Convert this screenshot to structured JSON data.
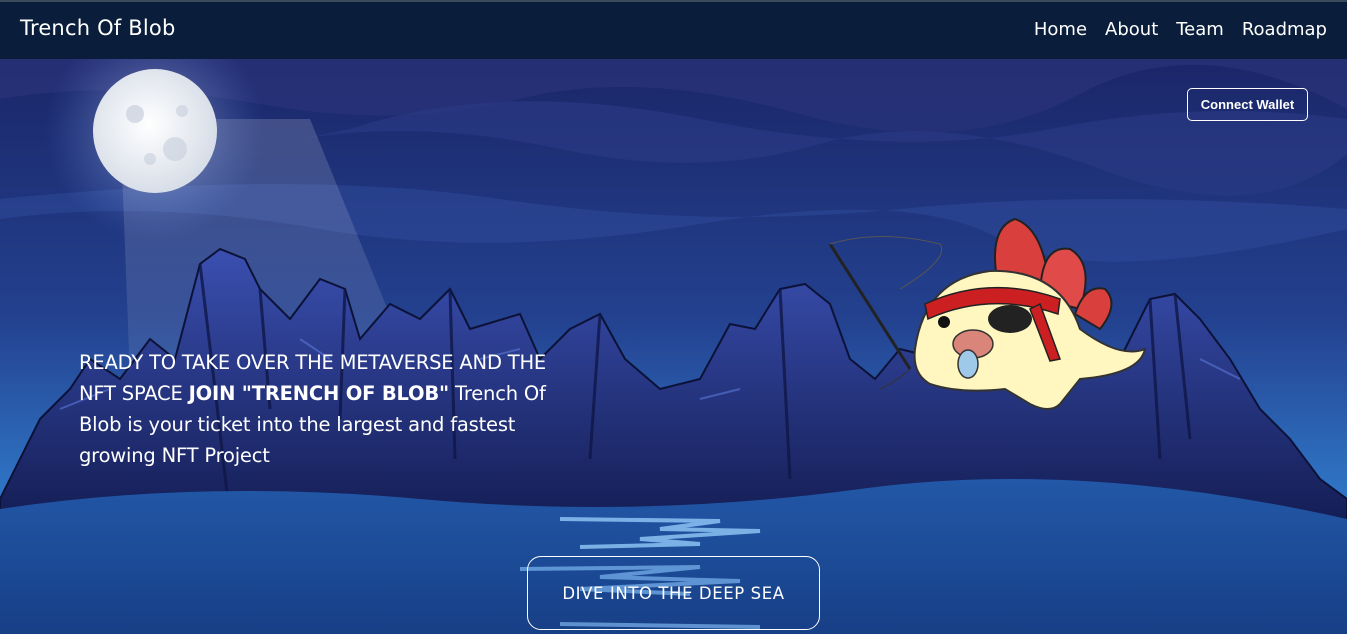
{
  "nav": {
    "brand": "Trench Of Blob",
    "links": [
      {
        "label": "Home"
      },
      {
        "label": "About"
      },
      {
        "label": "Team"
      },
      {
        "label": "Roadmap"
      }
    ]
  },
  "hero": {
    "connect_label": "Connect Wallet",
    "tagline_part1": "READY TO TAKE OVER THE METAVERSE AND THE NFT SPACE ",
    "tagline_bold": "JOIN \"TRENCH OF BLOB\"",
    "tagline_part2": " Trench Of Blob is your ticket into the largest and fastest growing NFT Project",
    "cta_label": "DIVE INTO THE DEEP SEA"
  },
  "colors": {
    "nav_bg": "#0a1e3b",
    "sky_top": "#1b2a6b",
    "sky_bottom": "#2f6fbf",
    "rock": "#1d2a6a",
    "water": "#1e4f9c"
  }
}
